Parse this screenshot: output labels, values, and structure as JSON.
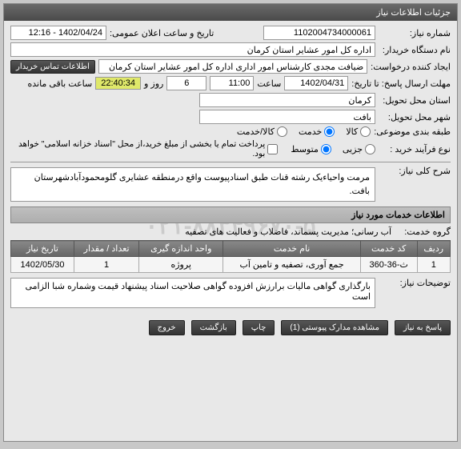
{
  "title": "جزئیات اطلاعات نیاز",
  "fields": {
    "need_no_label": "شماره نیاز:",
    "need_no": "1102004734000061",
    "announce_label": "تاریخ و ساعت اعلان عمومی:",
    "announce": "1402/04/24 - 12:16",
    "buyer_dev_label": "نام دستگاه خریدار:",
    "buyer_dev": "اداره کل امور عشایر استان کرمان",
    "creator_label": "ایجاد کننده درخواست:",
    "creator": "ضیافت مجدی کارشناس امور اداری اداره کل امور عشایر استان کرمان",
    "contact_btn": "اطلاعات تماس خریدار",
    "deadline_label": "مهلت ارسال پاسخ: تا تاریخ:",
    "deadline_date": "1402/04/31",
    "time_label": "ساعت",
    "deadline_time": "11:00",
    "days": "6",
    "days_label": "روز و",
    "countdown": "22:40:34",
    "remaining_label": "ساعت باقی مانده",
    "province_label": "استان محل تحویل:",
    "province": "کرمان",
    "city_label": "شهر محل تحویل:",
    "city": "بافت",
    "class_label": "طبقه بندی موضوعی:",
    "goods": "کالا",
    "service": "خدمت",
    "goods_service": "کالا/خدمت",
    "purchase_type_label": "نوع فرآیند خرید :",
    "minor": "جزیی",
    "medium": "متوسط",
    "payment_note": "پرداخت تمام یا بخشی از مبلغ خرید،از محل \"اسناد خزانه اسلامی\" خواهد بود.",
    "need_desc_label": "شرح کلی نیاز:",
    "need_desc": "مرمت واحیاءیک رشته قنات طبق اسنادپیوست واقع درمنطقه عشایری گلومحمودآبادشهرستان بافت.",
    "services_header": "اطلاعات خدمات مورد نیاز",
    "service_group_label": "گروه خدمت:",
    "service_group": "آب رسانی؛ مدیریت پسماند، فاضلاب و فعالیت های تصفیه"
  },
  "table": {
    "headers": {
      "row": "ردیف",
      "code": "کد خدمت",
      "name": "نام خدمت",
      "unit": "واحد اندازه گیری",
      "qty": "تعداد / مقدار",
      "date": "تاریخ نیاز"
    },
    "rows": [
      {
        "row": "1",
        "code": "ث-36-360",
        "name": "جمع آوری، تصفیه و تامین آب",
        "unit": "پروژه",
        "qty": "1",
        "date": "1402/05/30"
      }
    ]
  },
  "notes_label": "توضیحات نیاز:",
  "notes": "بارگذاری گواهی مالیات برارزش افزوده گواهی صلاحیت اسناد پیشنهاد قیمت وشماره شبا الزامی است",
  "footer": {
    "respond": "پاسخ به نیاز",
    "attachments": "مشاهده مدارک پیوستی (1)",
    "print": "چاپ",
    "back": "بازگشت",
    "exit": "خروج"
  }
}
